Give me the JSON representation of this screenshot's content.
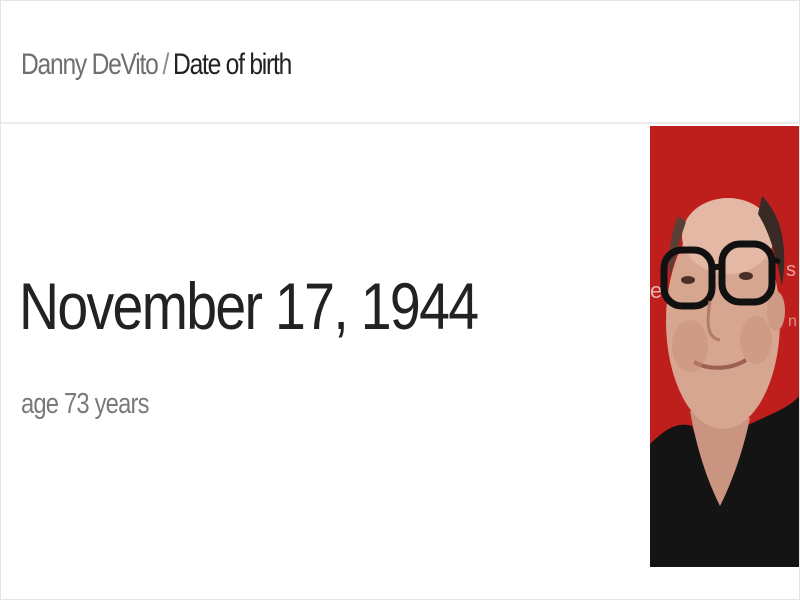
{
  "breadcrumb": {
    "entity": "Danny DeVito",
    "separator": "/",
    "attribute": "Date of birth"
  },
  "answer": {
    "value": "November 17, 1944",
    "subtext": "age 73 years"
  },
  "image": {
    "alt": "Danny DeVito",
    "background_color": "#c8231f"
  }
}
